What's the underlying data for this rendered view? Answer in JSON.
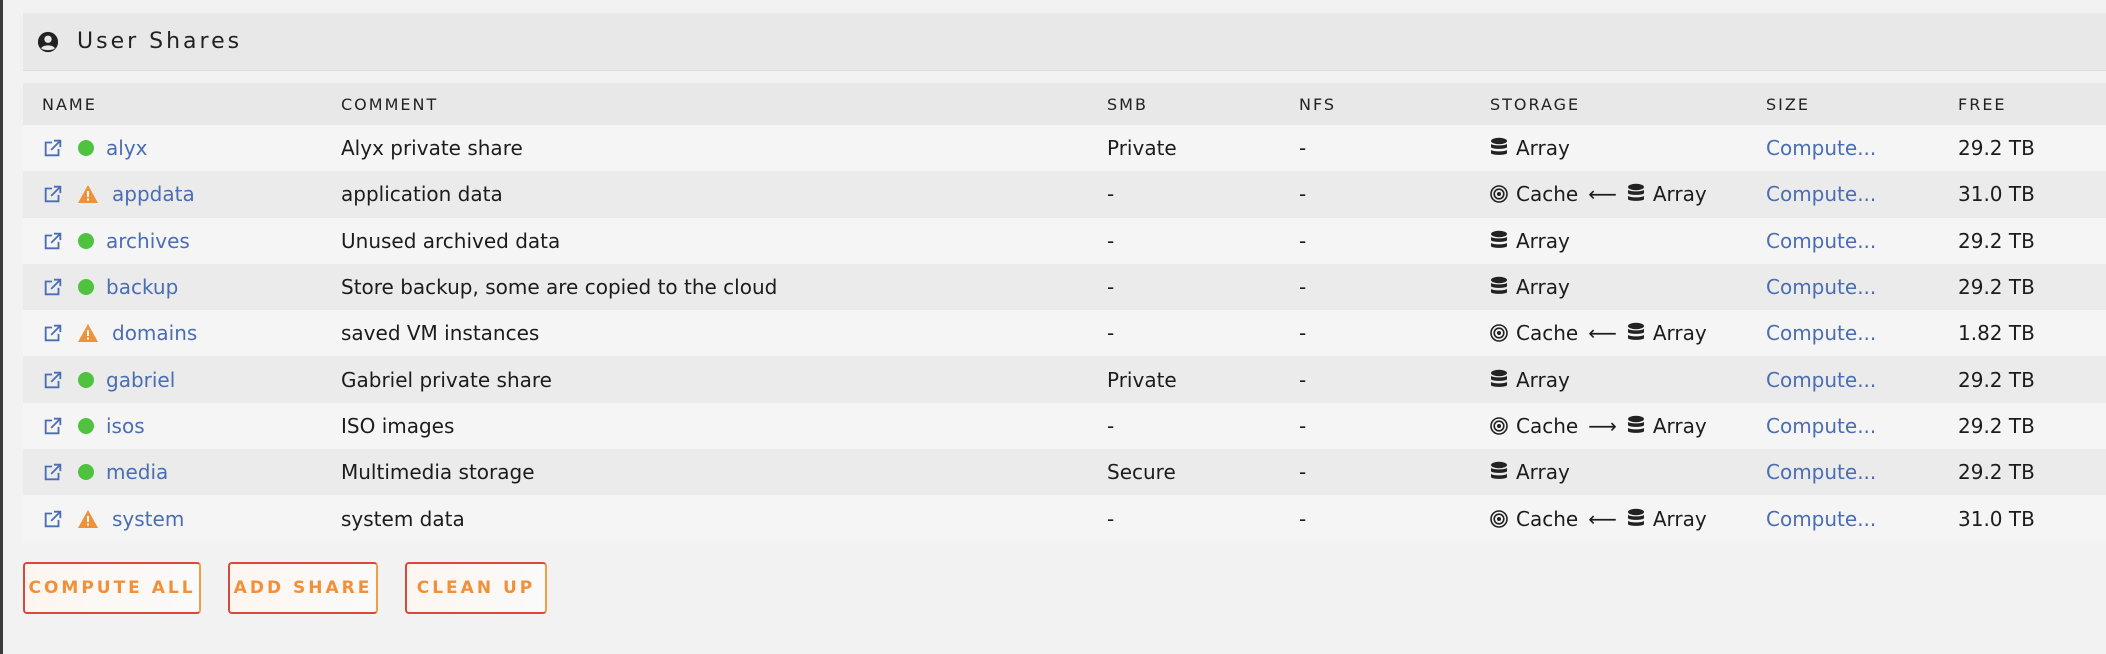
{
  "header": {
    "title": "User Shares",
    "icon": "user-circle-icon"
  },
  "columns": {
    "name": "NAME",
    "comment": "COMMENT",
    "smb": "SMB",
    "nfs": "NFS",
    "storage": "STORAGE",
    "size": "SIZE",
    "free": "FREE"
  },
  "labels": {
    "cache": "Cache",
    "array": "Array",
    "arrow_left": "⟵",
    "arrow_right": "⟶"
  },
  "colors": {
    "ok": "#4fc33f",
    "warn": "#f0903a",
    "link": "#4a6db3",
    "button": "#f0903a"
  },
  "shares": [
    {
      "name": "alyx",
      "status": "ok",
      "comment": "Alyx private share",
      "smb": "Private",
      "nfs": "-",
      "storage": "array",
      "size": "Compute...",
      "free": "29.2 TB"
    },
    {
      "name": "appdata",
      "status": "warn",
      "comment": "application data",
      "smb": "-",
      "nfs": "-",
      "storage": "cache-left-array",
      "size": "Compute...",
      "free": "31.0 TB"
    },
    {
      "name": "archives",
      "status": "ok",
      "comment": "Unused archived data",
      "smb": "-",
      "nfs": "-",
      "storage": "array",
      "size": "Compute...",
      "free": "29.2 TB"
    },
    {
      "name": "backup",
      "status": "ok",
      "comment": "Store backup, some are copied to the cloud",
      "smb": "-",
      "nfs": "-",
      "storage": "array",
      "size": "Compute...",
      "free": "29.2 TB"
    },
    {
      "name": "domains",
      "status": "warn",
      "comment": "saved VM instances",
      "smb": "-",
      "nfs": "-",
      "storage": "cache-left-array",
      "size": "Compute...",
      "free": "1.82 TB"
    },
    {
      "name": "gabriel",
      "status": "ok",
      "comment": "Gabriel private share",
      "smb": "Private",
      "nfs": "-",
      "storage": "array",
      "size": "Compute...",
      "free": "29.2 TB"
    },
    {
      "name": "isos",
      "status": "ok",
      "comment": "ISO images",
      "smb": "-",
      "nfs": "-",
      "storage": "cache-right-array",
      "size": "Compute...",
      "free": "29.2 TB"
    },
    {
      "name": "media",
      "status": "ok",
      "comment": "Multimedia storage",
      "smb": "Secure",
      "nfs": "-",
      "storage": "array",
      "size": "Compute...",
      "free": "29.2 TB"
    },
    {
      "name": "system",
      "status": "warn",
      "comment": "system data",
      "smb": "-",
      "nfs": "-",
      "storage": "cache-left-array",
      "size": "Compute...",
      "free": "31.0 TB"
    }
  ],
  "buttons": {
    "compute_all": "COMPUTE ALL",
    "add_share": "ADD SHARE",
    "clean_up": "CLEAN UP"
  }
}
